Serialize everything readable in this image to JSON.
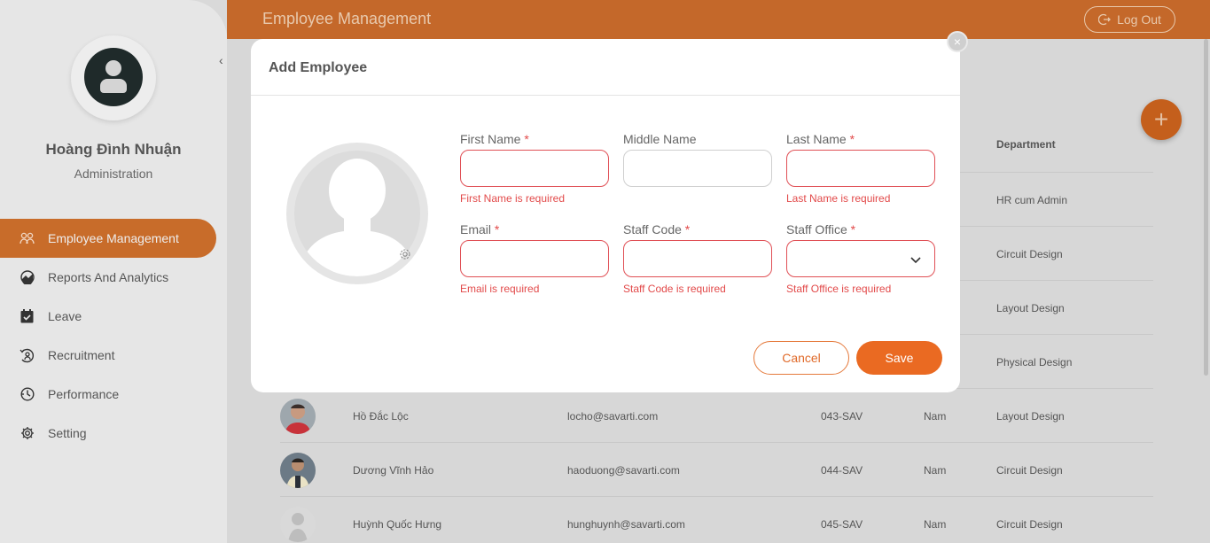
{
  "header": {
    "title": "Employee Management",
    "logout_label": "Log Out"
  },
  "user": {
    "name": "Hoàng Đình Nhuận",
    "role": "Administration"
  },
  "sidebar": {
    "items": [
      {
        "label": "Employee Management",
        "icon": "people-icon",
        "active": true
      },
      {
        "label": "Reports And Analytics",
        "icon": "chart-icon",
        "active": false
      },
      {
        "label": "Leave",
        "icon": "calendar-check-icon",
        "active": false
      },
      {
        "label": "Recruitment",
        "icon": "recruit-icon",
        "active": false
      },
      {
        "label": "Performance",
        "icon": "performance-icon",
        "active": false
      },
      {
        "label": "Setting",
        "icon": "gear-icon",
        "active": false
      }
    ]
  },
  "table": {
    "department_header": "Department",
    "rows_partial": [
      "HR cum Admin",
      "Circuit Design",
      "Layout Design",
      "Physical Design"
    ],
    "rows": [
      {
        "name": "Hồ Đắc Lộc",
        "email": "locho@savarti.com",
        "code": "043-SAV",
        "gender": "Nam",
        "department": "Layout Design"
      },
      {
        "name": "Dương Vĩnh Hảo",
        "email": "haoduong@savarti.com",
        "code": "044-SAV",
        "gender": "Nam",
        "department": "Circuit Design"
      },
      {
        "name": "Huỳnh Quốc Hưng",
        "email": "hunghuynh@savarti.com",
        "code": "045-SAV",
        "gender": "Nam",
        "department": "Circuit Design"
      }
    ]
  },
  "fab": {
    "label": "+"
  },
  "modal": {
    "title": "Add Employee",
    "close_label": "×",
    "fields": {
      "first_name": {
        "label": "First Name",
        "required": "*",
        "value": "",
        "error": "First Name is required"
      },
      "middle_name": {
        "label": "Middle Name",
        "value": ""
      },
      "last_name": {
        "label": "Last Name",
        "required": "*",
        "value": "",
        "error": "Last Name is required"
      },
      "email": {
        "label": "Email",
        "required": "*",
        "value": "",
        "error": "Email is required"
      },
      "staff_code": {
        "label": "Staff Code",
        "required": "*",
        "value": "",
        "error": "Staff Code is required"
      },
      "staff_office": {
        "label": "Staff Office",
        "required": "*",
        "value": "",
        "error": "Staff Office is required"
      }
    },
    "cancel_label": "Cancel",
    "save_label": "Save"
  },
  "colors": {
    "accent": "#ea6a22",
    "header": "#c4682a",
    "error": "#e24a4a"
  }
}
